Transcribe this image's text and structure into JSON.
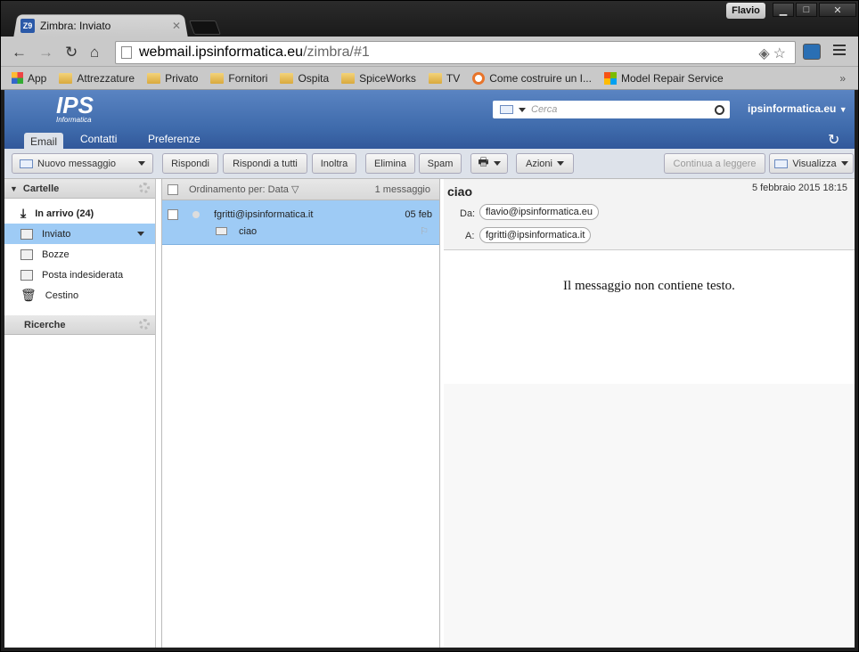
{
  "browser": {
    "tab_title": "Zimbra: Inviato",
    "tab_favicon": "Z9",
    "profile_name": "Flavio",
    "url_host": "webmail.ipsinformatica.eu",
    "url_path": "/zimbra/#1",
    "bookmarks": [
      "App",
      "Attrezzature",
      "Privato",
      "Fornitori",
      "Ospita",
      "SpiceWorks",
      "TV",
      "Come costruire un I...",
      "Model Repair Service"
    ]
  },
  "zimbra": {
    "logo": "IPS",
    "logo_sub": "Informatica",
    "search_placeholder": "Cerca",
    "account": "ipsinformatica.eu",
    "tabs": [
      "Email",
      "Contatti",
      "Preferenze"
    ],
    "toolbar": {
      "new_message": "Nuovo messaggio",
      "reply": "Rispondi",
      "reply_all": "Rispondi a tutti",
      "forward": "Inoltra",
      "delete": "Elimina",
      "spam": "Spam",
      "actions": "Azioni",
      "continue_reading": "Continua a leggere",
      "view": "Visualizza"
    },
    "folders_header": "Cartelle",
    "folders": [
      {
        "label": "In arrivo (24)",
        "icon": "inbox-icon"
      },
      {
        "label": "Inviato",
        "icon": "sent-icon"
      },
      {
        "label": "Bozze",
        "icon": "drafts-icon"
      },
      {
        "label": "Posta indesiderata",
        "icon": "junk-icon"
      },
      {
        "label": "Cestino",
        "icon": "trash-icon"
      }
    ],
    "searches_header": "Ricerche",
    "list": {
      "sort_label": "Ordinamento per: Data",
      "count": "1 messaggio",
      "messages": [
        {
          "from": "fgritti@ipsinformatica.it",
          "date": "05 feb",
          "subject": "ciao"
        }
      ]
    },
    "reading": {
      "subject": "ciao",
      "date": "5 febbraio 2015 18:15",
      "from_label": "Da:",
      "from": "flavio@ipsinformatica.eu",
      "to_label": "A:",
      "to": "fgritti@ipsinformatica.it",
      "body": "Il messaggio non contiene testo."
    }
  }
}
